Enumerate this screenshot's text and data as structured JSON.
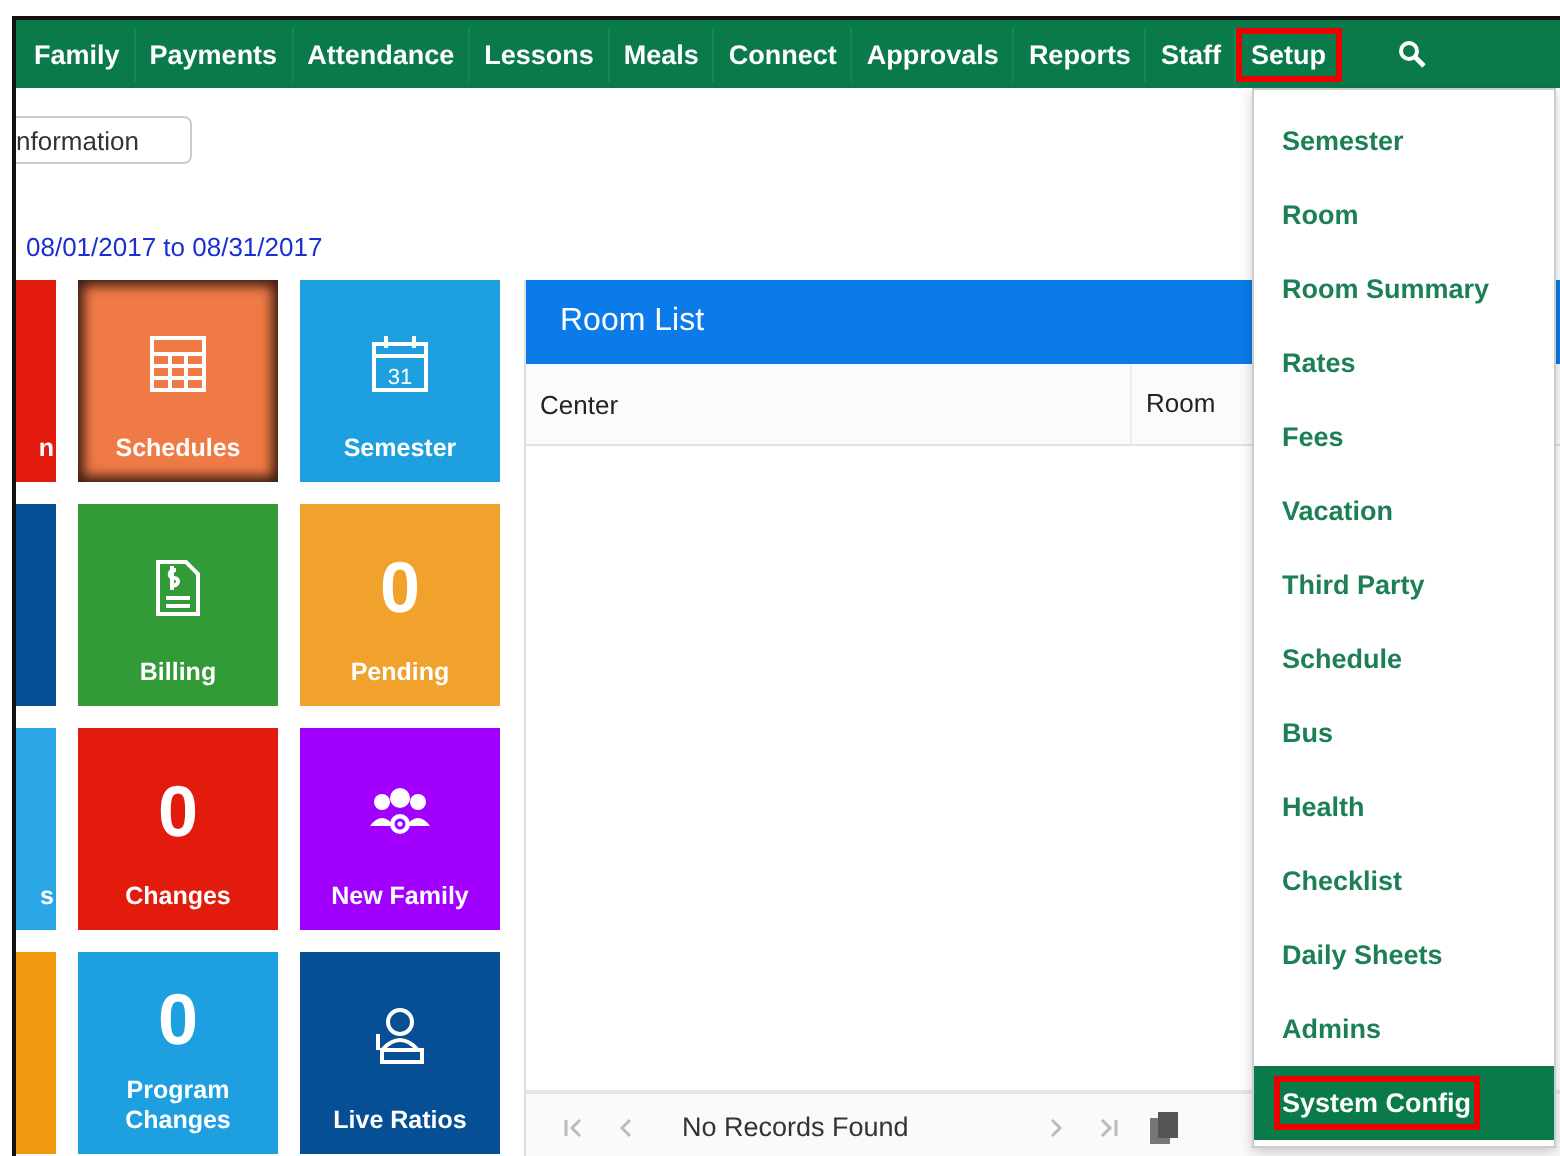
{
  "nav": [
    {
      "label": "Family",
      "outlined": false
    },
    {
      "label": "Payments",
      "outlined": false
    },
    {
      "label": "Attendance",
      "outlined": false
    },
    {
      "label": "Lessons",
      "outlined": false
    },
    {
      "label": "Meals",
      "outlined": false
    },
    {
      "label": "Connect",
      "outlined": false
    },
    {
      "label": "Approvals",
      "outlined": false
    },
    {
      "label": "Reports",
      "outlined": false
    },
    {
      "label": "Staff",
      "outlined": false
    },
    {
      "label": "Setup",
      "outlined": true
    }
  ],
  "info_button": "nformation",
  "date_range": "08/01/2017 to 08/31/2017",
  "tiles": [
    {
      "kind": "partial",
      "label": "n",
      "color": "#e31b0c"
    },
    {
      "kind": "icon",
      "label": "Schedules",
      "color": "#f07a45",
      "focused": true
    },
    {
      "kind": "icon",
      "icon_label": "31",
      "label": "Semester",
      "color": "#1ea0e0",
      "focused": false
    },
    {
      "kind": "partial",
      "color": "#064f94"
    },
    {
      "kind": "icon",
      "label": "Billing",
      "color": "#339a38",
      "focused": false
    },
    {
      "kind": "count",
      "count": "0",
      "label": "Pending",
      "color": "#f0a22c",
      "focused": false
    },
    {
      "kind": "partial",
      "label": "s",
      "color": "#2aa6e6"
    },
    {
      "kind": "count",
      "count": "0",
      "label": "Changes",
      "color": "#e31b0c",
      "focused": false
    },
    {
      "kind": "icon",
      "label": "New Family",
      "color": "#a100ff",
      "focused": false
    },
    {
      "kind": "partial",
      "color": "#f0980e"
    },
    {
      "kind": "count",
      "count": "0",
      "label": "Program Changes",
      "color": "#1ea0e0",
      "focused": false
    },
    {
      "kind": "icon",
      "label": "Live Ratios",
      "color": "#064f94",
      "focused": false
    }
  ],
  "room_list": {
    "title": "Room List",
    "columns": [
      "Center",
      "Room"
    ],
    "empty_text": "No Records Found"
  },
  "setup_menu": [
    {
      "label": "Semester",
      "selected": false,
      "outlined": false
    },
    {
      "label": "Room",
      "selected": false,
      "outlined": false
    },
    {
      "label": "Room Summary",
      "selected": false,
      "outlined": false
    },
    {
      "label": "Rates",
      "selected": false,
      "outlined": false
    },
    {
      "label": "Fees",
      "selected": false,
      "outlined": false
    },
    {
      "label": "Vacation",
      "selected": false,
      "outlined": false
    },
    {
      "label": "Third Party",
      "selected": false,
      "outlined": false
    },
    {
      "label": "Schedule",
      "selected": false,
      "outlined": false
    },
    {
      "label": "Bus",
      "selected": false,
      "outlined": false
    },
    {
      "label": "Health",
      "selected": false,
      "outlined": false
    },
    {
      "label": "Checklist",
      "selected": false,
      "outlined": false
    },
    {
      "label": "Daily Sheets",
      "selected": false,
      "outlined": false
    },
    {
      "label": "Admins",
      "selected": false,
      "outlined": false
    },
    {
      "label": "System Config",
      "selected": true,
      "outlined": true
    }
  ]
}
